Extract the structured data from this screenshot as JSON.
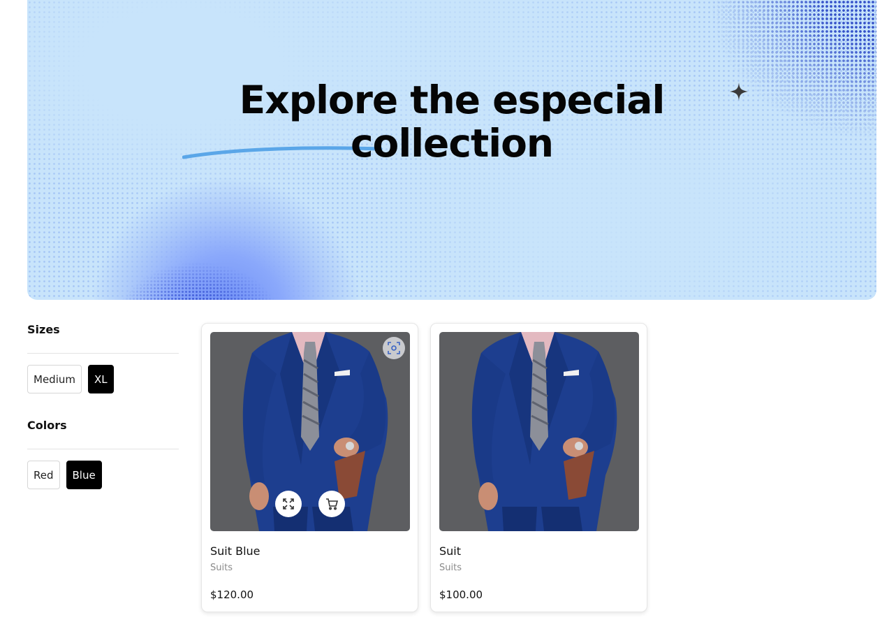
{
  "hero": {
    "title_line1": "Explore the especial",
    "title_line2": "collection",
    "background_color": "#c8e4fb",
    "accent_color": "#5aa6e8"
  },
  "filters": {
    "sizes": {
      "title": "Sizes",
      "options": [
        {
          "label": "Medium",
          "selected": false
        },
        {
          "label": "XL",
          "selected": true
        }
      ]
    },
    "colors": {
      "title": "Colors",
      "options": [
        {
          "label": "Red",
          "selected": false
        },
        {
          "label": "Blue",
          "selected": true
        }
      ]
    }
  },
  "products": [
    {
      "name": "Suit Blue",
      "category": "Suits",
      "price": "$120.00",
      "icons": [
        "scan-icon",
        "expand-icon",
        "cart-icon"
      ]
    },
    {
      "name": "Suit",
      "category": "Suits",
      "price": "$100.00",
      "icons": []
    }
  ]
}
